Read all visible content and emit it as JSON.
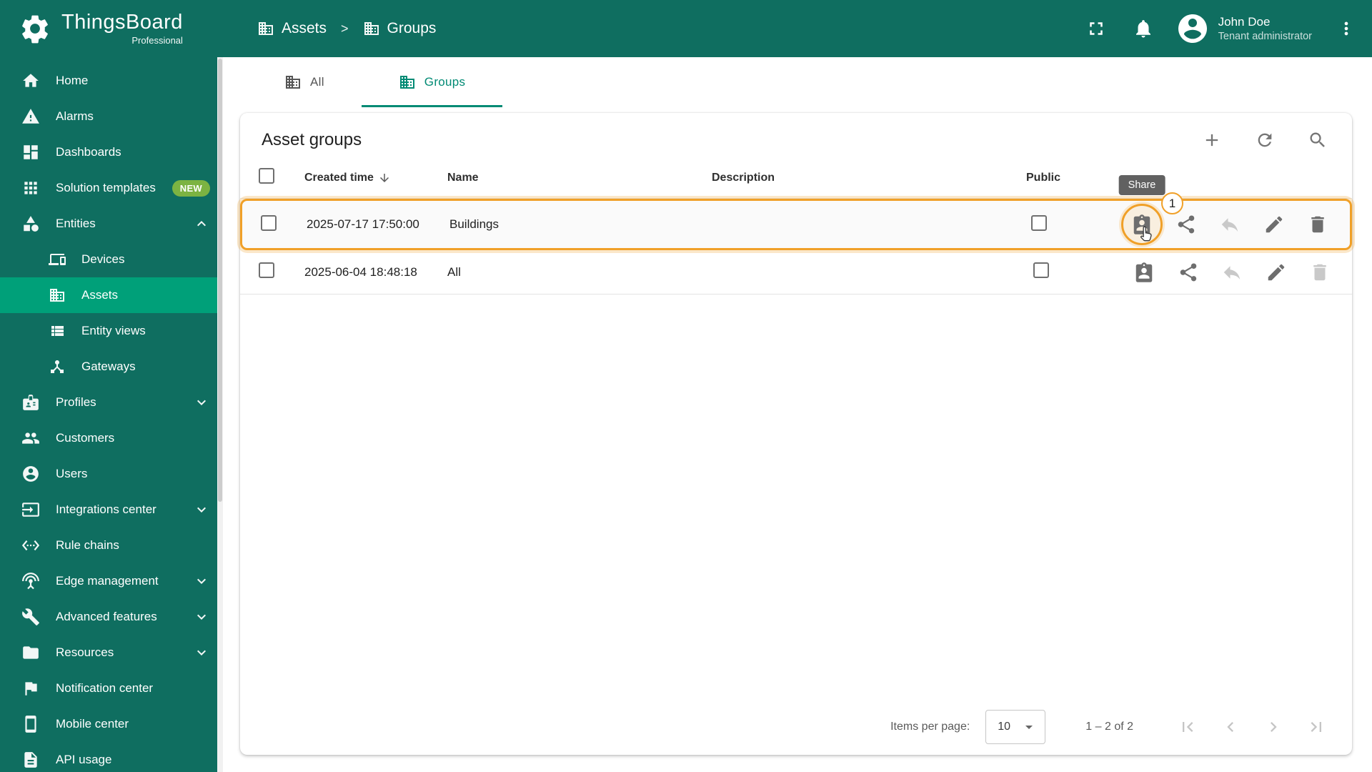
{
  "colors": {
    "primary": "#0f6e60",
    "primary_selected": "#00a079",
    "accent": "#008a74",
    "highlight": "#f0a028",
    "badge_new": "#7cb342",
    "tooltip_bg": "#616161"
  },
  "header": {
    "logo_title": "ThingsBoard",
    "logo_subtitle": "Professional",
    "breadcrumb": [
      {
        "label": "Assets"
      },
      {
        "label": "Groups"
      }
    ],
    "breadcrumb_separator": ">",
    "user_name": "John Doe",
    "user_role": "Tenant administrator"
  },
  "sidebar": {
    "items": [
      {
        "label": "Home"
      },
      {
        "label": "Alarms"
      },
      {
        "label": "Dashboards"
      },
      {
        "label": "Solution templates",
        "badge": "NEW"
      },
      {
        "label": "Entities",
        "expanded": true
      },
      {
        "label": "Devices",
        "sub": true
      },
      {
        "label": "Assets",
        "sub": true,
        "selected": true
      },
      {
        "label": "Entity views",
        "sub": true
      },
      {
        "label": "Gateways",
        "sub": true
      },
      {
        "label": "Profiles",
        "collapsible": true
      },
      {
        "label": "Customers"
      },
      {
        "label": "Users"
      },
      {
        "label": "Integrations center",
        "collapsible": true
      },
      {
        "label": "Rule chains"
      },
      {
        "label": "Edge management",
        "collapsible": true
      },
      {
        "label": "Advanced features",
        "collapsible": true
      },
      {
        "label": "Resources",
        "collapsible": true
      },
      {
        "label": "Notification center"
      },
      {
        "label": "Mobile center"
      },
      {
        "label": "API usage"
      }
    ]
  },
  "tabs": [
    {
      "label": "All"
    },
    {
      "label": "Groups",
      "active": true
    }
  ],
  "card": {
    "title": "Asset groups"
  },
  "table": {
    "columns": [
      "Created time",
      "Name",
      "Description",
      "Public"
    ],
    "sort_column": "Created time",
    "sort_direction": "desc",
    "rows": [
      {
        "created_time": "2025-07-17 17:50:00",
        "name": "Buildings",
        "description": "",
        "public": false
      },
      {
        "created_time": "2025-06-04 18:48:18",
        "name": "All",
        "description": "",
        "public": false
      }
    ]
  },
  "annotation": {
    "tooltip": "Share",
    "step": "1"
  },
  "pagination": {
    "items_per_page_label": "Items per page:",
    "items_per_page_value": "10",
    "range_label": "1 – 2 of 2"
  },
  "icons": {
    "logo": "gear",
    "breadcrumb-entity": "building",
    "fullscreen": "expand-corners",
    "notifications": "bell",
    "user-avatar": "account-circle",
    "more-menu": "vertical-dots",
    "add": "plus",
    "refresh": "circular-arrow",
    "search": "magnifier",
    "sort-desc": "arrow-down",
    "manage-group-users": "badge-person",
    "share": "share-nodes",
    "make-private": "reply-arrow",
    "edit": "pencil",
    "delete": "trash",
    "first-page": "bar-chevron-left",
    "prev-page": "chevron-left",
    "next-page": "chevron-right",
    "last-page": "bar-chevron-right",
    "items-per-page-caret": "caret-down"
  }
}
